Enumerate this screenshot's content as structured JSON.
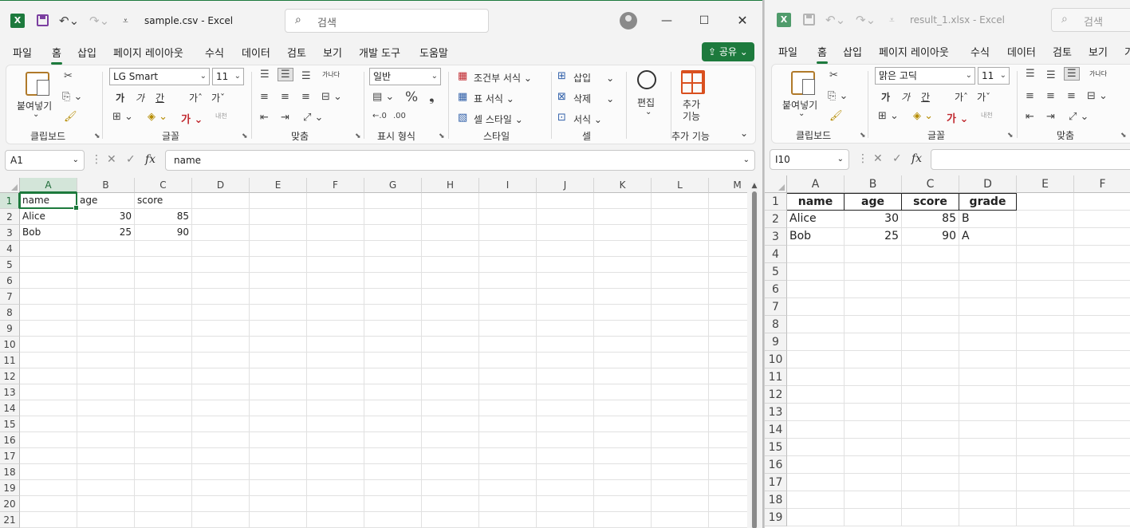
{
  "colors": {
    "accent": "#1d7a3d",
    "selected_header": "#d3e5d9"
  },
  "left": {
    "window_title": "sample.csv  -  Excel",
    "search_placeholder": "검색",
    "menu_tabs": [
      "파일",
      "홈",
      "삽입",
      "페이지 레이아웃",
      "수식",
      "데이터",
      "검토",
      "보기",
      "개발 도구",
      "도움말"
    ],
    "active_tab": "홈",
    "share_label": "공유",
    "ribbon": {
      "clipboard": {
        "paste": "붙여넣기",
        "group": "클립보드"
      },
      "font": {
        "name": "LG Smart",
        "size": "11",
        "group": "글꼴",
        "bold": "가",
        "italic": "가",
        "underline": "간",
        "grow": "가ˆ",
        "shrink": "가ˇ",
        "phonetic": "내천"
      },
      "alignment": {
        "group": "맞춤",
        "wrap": "가나다"
      },
      "number": {
        "format": "일반",
        "group": "표시 형식"
      },
      "styles": {
        "conditional": "조건부 서식",
        "table": "표 서식",
        "cell_styles": "셀 스타일",
        "group": "스타일"
      },
      "cells": {
        "insert": "삽입",
        "delete": "삭제",
        "format": "서식",
        "group": "셀"
      },
      "editing": {
        "label": "편집"
      },
      "addins": {
        "label_1": "추가",
        "label_2": "기능",
        "group": "추가 기능"
      }
    },
    "name_box": "A1",
    "formula": "name",
    "columns": [
      "A",
      "B",
      "C",
      "D",
      "E",
      "F",
      "G",
      "H",
      "I",
      "J",
      "K",
      "L",
      "M"
    ],
    "rows": [
      "1",
      "2",
      "3",
      "4",
      "5",
      "6",
      "7",
      "8",
      "9",
      "10",
      "11",
      "12",
      "13",
      "14",
      "15",
      "16",
      "17",
      "18",
      "19",
      "20",
      "21"
    ],
    "cells": [
      [
        "name",
        "age",
        "score"
      ],
      [
        "Alice",
        "30",
        "85"
      ],
      [
        "Bob",
        "25",
        "90"
      ]
    ]
  },
  "right": {
    "window_title": "result_1.xlsx  -  Excel",
    "search_placeholder": "검색",
    "menu_tabs": [
      "파일",
      "홈",
      "삽입",
      "페이지 레이아웃",
      "수식",
      "데이터",
      "검토",
      "보기",
      "가"
    ],
    "active_tab": "홈",
    "ribbon": {
      "clipboard": {
        "paste": "붙여넣기",
        "group": "클립보드"
      },
      "font": {
        "name": "맑은 고딕",
        "size": "11",
        "group": "글꼴",
        "bold": "가",
        "italic": "가",
        "underline": "간",
        "grow": "가ˆ",
        "shrink": "가ˇ",
        "phonetic": "내천"
      },
      "alignment": {
        "group": "맞춤",
        "wrap": "가나다"
      }
    },
    "name_box": "I10",
    "formula": "",
    "columns": [
      "A",
      "B",
      "C",
      "D",
      "E",
      "F"
    ],
    "rows": [
      "1",
      "2",
      "3",
      "4",
      "5",
      "6",
      "7",
      "8",
      "9",
      "10",
      "11",
      "12",
      "13",
      "14",
      "15",
      "16",
      "17",
      "18",
      "19"
    ],
    "cells": [
      [
        "name",
        "age",
        "score",
        "grade"
      ],
      [
        "Alice",
        "30",
        "85",
        "B"
      ],
      [
        "Bob",
        "25",
        "90",
        "A"
      ]
    ]
  }
}
